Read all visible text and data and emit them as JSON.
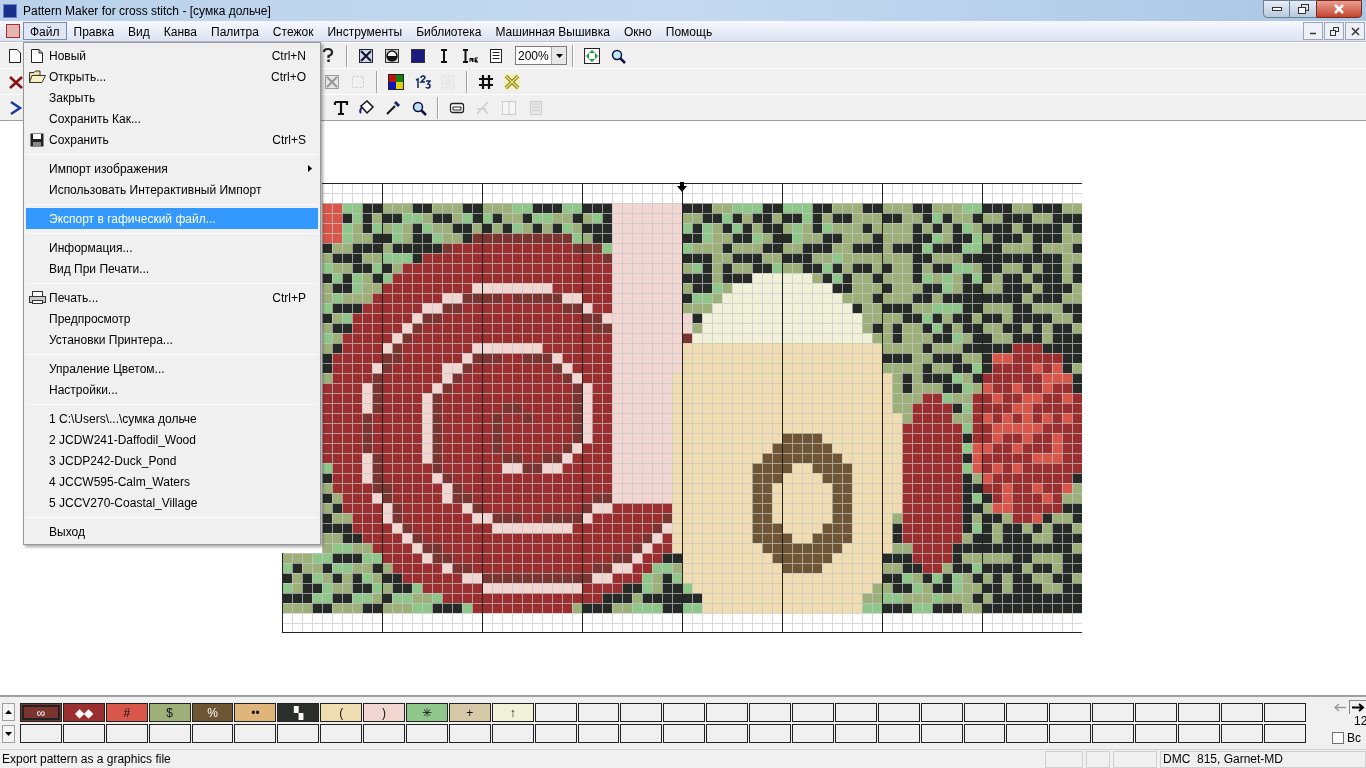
{
  "window": {
    "title": "Pattern Maker for cross stitch - [сумка дольче]"
  },
  "menu_bar": [
    {
      "label": "Файл",
      "selected": true
    },
    {
      "label": "Правка",
      "selected": false
    },
    {
      "label": "Вид",
      "selected": false
    },
    {
      "label": "Канва",
      "selected": false
    },
    {
      "label": "Палитра",
      "selected": false
    },
    {
      "label": "Стежок",
      "selected": false
    },
    {
      "label": "Инструменты",
      "selected": false
    },
    {
      "label": "Библиотека",
      "selected": false
    },
    {
      "label": "Машинная Вышивка",
      "selected": false
    },
    {
      "label": "Окно",
      "selected": false
    },
    {
      "label": "Помощь",
      "selected": false
    }
  ],
  "file_menu": [
    [
      {
        "kind": "new",
        "label": "Новый",
        "shortcut": "Ctrl+N",
        "submenu": false,
        "selected": false
      },
      {
        "kind": "open",
        "label": "Открыть...",
        "shortcut": "Ctrl+O",
        "submenu": false,
        "selected": false
      },
      {
        "kind": "plain",
        "label": "Закрыть",
        "submenu": false,
        "selected": false
      },
      {
        "kind": "plain",
        "label": "Сохранить Как...",
        "submenu": false,
        "selected": false
      },
      {
        "kind": "save",
        "label": "Сохранить",
        "shortcut": "Ctrl+S",
        "submenu": false,
        "selected": false
      }
    ],
    [
      {
        "kind": "plain",
        "label": "Импорт изображения",
        "submenu": true,
        "selected": false
      },
      {
        "kind": "plain",
        "label": "Использовать Интерактивный Импорт",
        "submenu": false,
        "selected": false
      }
    ],
    [
      {
        "kind": "plain",
        "label": "Экспорт в гафический файл...",
        "submenu": false,
        "selected": true
      }
    ],
    [
      {
        "kind": "plain",
        "label": "Информация...",
        "submenu": false,
        "selected": false
      },
      {
        "kind": "plain",
        "label": "Вид При Печати...",
        "submenu": false,
        "selected": false
      }
    ],
    [
      {
        "kind": "print",
        "label": "Печать...",
        "shortcut": "Ctrl+P",
        "submenu": false,
        "selected": false
      },
      {
        "kind": "plain",
        "label": "Предпросмотр",
        "submenu": false,
        "selected": false
      },
      {
        "kind": "plain",
        "label": "Установки Принтера...",
        "submenu": false,
        "selected": false
      }
    ],
    [
      {
        "kind": "plain",
        "label": "Упраление Цветом...",
        "submenu": false,
        "selected": false
      },
      {
        "kind": "plain",
        "label": "Настройки...",
        "submenu": false,
        "selected": false
      }
    ],
    [
      {
        "kind": "plain",
        "label": "1 C:\\Users\\...\\сумка дольче",
        "submenu": false,
        "selected": false
      },
      {
        "kind": "plain",
        "label": "2 JCDW241-Daffodil_Wood",
        "submenu": false,
        "selected": false
      },
      {
        "kind": "plain",
        "label": "3 JCDP242-Duck_Pond",
        "submenu": false,
        "selected": false
      },
      {
        "kind": "plain",
        "label": "4 JCCW595-Calm_Waters",
        "submenu": false,
        "selected": false
      },
      {
        "kind": "plain",
        "label": "5 JCCV270-Coastal_Village",
        "submenu": false,
        "selected": false
      }
    ],
    [
      {
        "kind": "plain",
        "label": "Выход",
        "submenu": false,
        "selected": false
      }
    ]
  ],
  "toolbars": [
    [
      {
        "kind": "page",
        "disabled": false
      },
      {
        "kind": "help",
        "disabled": false
      },
      {
        "kind": "separator"
      },
      {
        "kind": "cross-box",
        "disabled": false
      },
      {
        "kind": "half-circle",
        "disabled": false
      },
      {
        "kind": "square",
        "disabled": false
      },
      {
        "kind": "text-cursor",
        "disabled": false
      },
      {
        "kind": "text-cursor-sub",
        "disabled": false
      },
      {
        "kind": "document",
        "disabled": false
      },
      {
        "kind": "zoom",
        "value": "200%"
      },
      {
        "kind": "separator"
      },
      {
        "kind": "fit",
        "disabled": false
      },
      {
        "kind": "zoom-tool",
        "disabled": false
      }
    ],
    [
      {
        "kind": "delete",
        "disabled": false
      },
      {
        "kind": "cross-box",
        "disabled": true
      },
      {
        "kind": "dashed-rect",
        "disabled": true
      },
      {
        "kind": "separator"
      },
      {
        "kind": "color-grid",
        "disabled": false
      },
      {
        "kind": "numbers",
        "disabled": false
      },
      {
        "kind": "sun",
        "disabled": true
      },
      {
        "kind": "separator"
      },
      {
        "kind": "grid",
        "disabled": false
      },
      {
        "kind": "big-cross",
        "disabled": false
      }
    ],
    [
      {
        "kind": "arrow",
        "disabled": false
      },
      {
        "kind": "text",
        "disabled": false
      },
      {
        "kind": "bucket",
        "disabled": false
      },
      {
        "kind": "dropper",
        "disabled": false
      },
      {
        "kind": "magnifier",
        "disabled": false
      },
      {
        "kind": "separator"
      },
      {
        "kind": "machine",
        "disabled": false
      },
      {
        "kind": "stitch",
        "disabled": true
      },
      {
        "kind": "split",
        "disabled": true
      },
      {
        "kind": "stack",
        "disabled": true
      }
    ]
  ],
  "palette": [
    {
      "symbol": "∞",
      "color": "#7a3530",
      "selected": true
    },
    {
      "symbol": "◆◆",
      "color": "#9b2f2f",
      "selected": false
    },
    {
      "symbol": "#",
      "color": "#d9574a",
      "selected": false
    },
    {
      "symbol": "$",
      "color": "#9db07a",
      "selected": false
    },
    {
      "symbol": "%",
      "color": "#6e5533",
      "selected": false
    },
    {
      "symbol": "••",
      "color": "#e0b57a",
      "selected": false
    },
    {
      "symbol": "▚",
      "color": "#2b2f2b",
      "selected": false
    },
    {
      "symbol": "(",
      "color": "#efdcb0",
      "selected": false
    },
    {
      "symbol": ")",
      "color": "#f2d6d2",
      "selected": false
    },
    {
      "symbol": "✳",
      "color": "#8fc78a",
      "selected": false
    },
    {
      "symbol": "+",
      "color": "#d6c9a8",
      "selected": false
    },
    {
      "symbol": "↑",
      "color": "#f1f0d8",
      "selected": false
    }
  ],
  "palette_side": {
    "count": "12",
    "checkbox": {
      "label": "Вс",
      "checked": false
    }
  },
  "status_bar": {
    "message": "Export pattern as a graphics file",
    "color_info": "DMC  815, Garnet-MD"
  }
}
